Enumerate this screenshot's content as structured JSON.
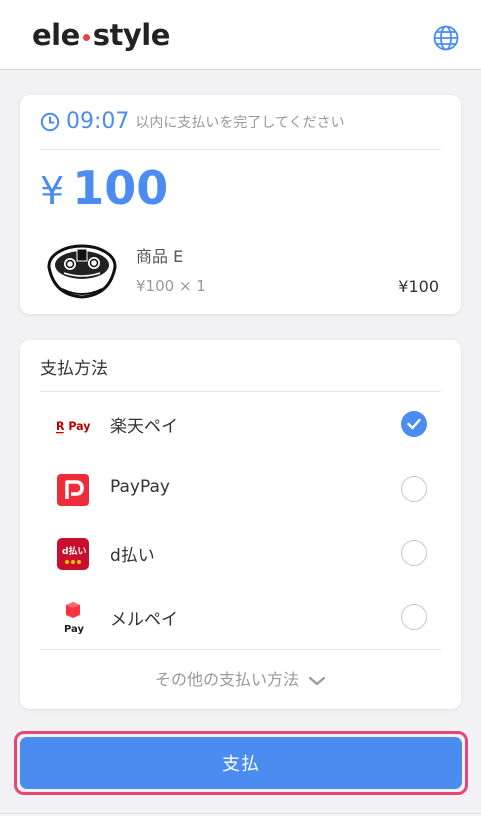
{
  "header": {
    "logo_left": "ele",
    "logo_right": "style",
    "language_icon": "globe-icon"
  },
  "order": {
    "time": "09:07",
    "time_message": "以内に支払いを完了してください",
    "currency_symbol": "¥",
    "amount": "100",
    "product_name": "商品 E",
    "product_qty": "¥100 × 1",
    "product_price": "¥100"
  },
  "payment": {
    "title": "支払方法",
    "methods": [
      {
        "label": "楽天ペイ",
        "icon": "rakuten-pay-icon",
        "selected": true
      },
      {
        "label": "PayPay",
        "icon": "paypay-icon",
        "selected": false
      },
      {
        "label": "d払い",
        "icon": "d-barai-icon",
        "selected": false
      },
      {
        "label": "メルペイ",
        "icon": "merpay-icon",
        "selected": false
      }
    ],
    "icon_texts": {
      "rakuten": "R Pay",
      "dbarai": "d払い",
      "merpay": "Pay"
    },
    "other_methods": "その他の支払い方法"
  },
  "pay_button": "支払",
  "colors": {
    "accent": "#4a8cf0",
    "highlight": "#e8457a",
    "paypay_red": "#ef2a39",
    "dbarai_red": "#c8102e"
  }
}
